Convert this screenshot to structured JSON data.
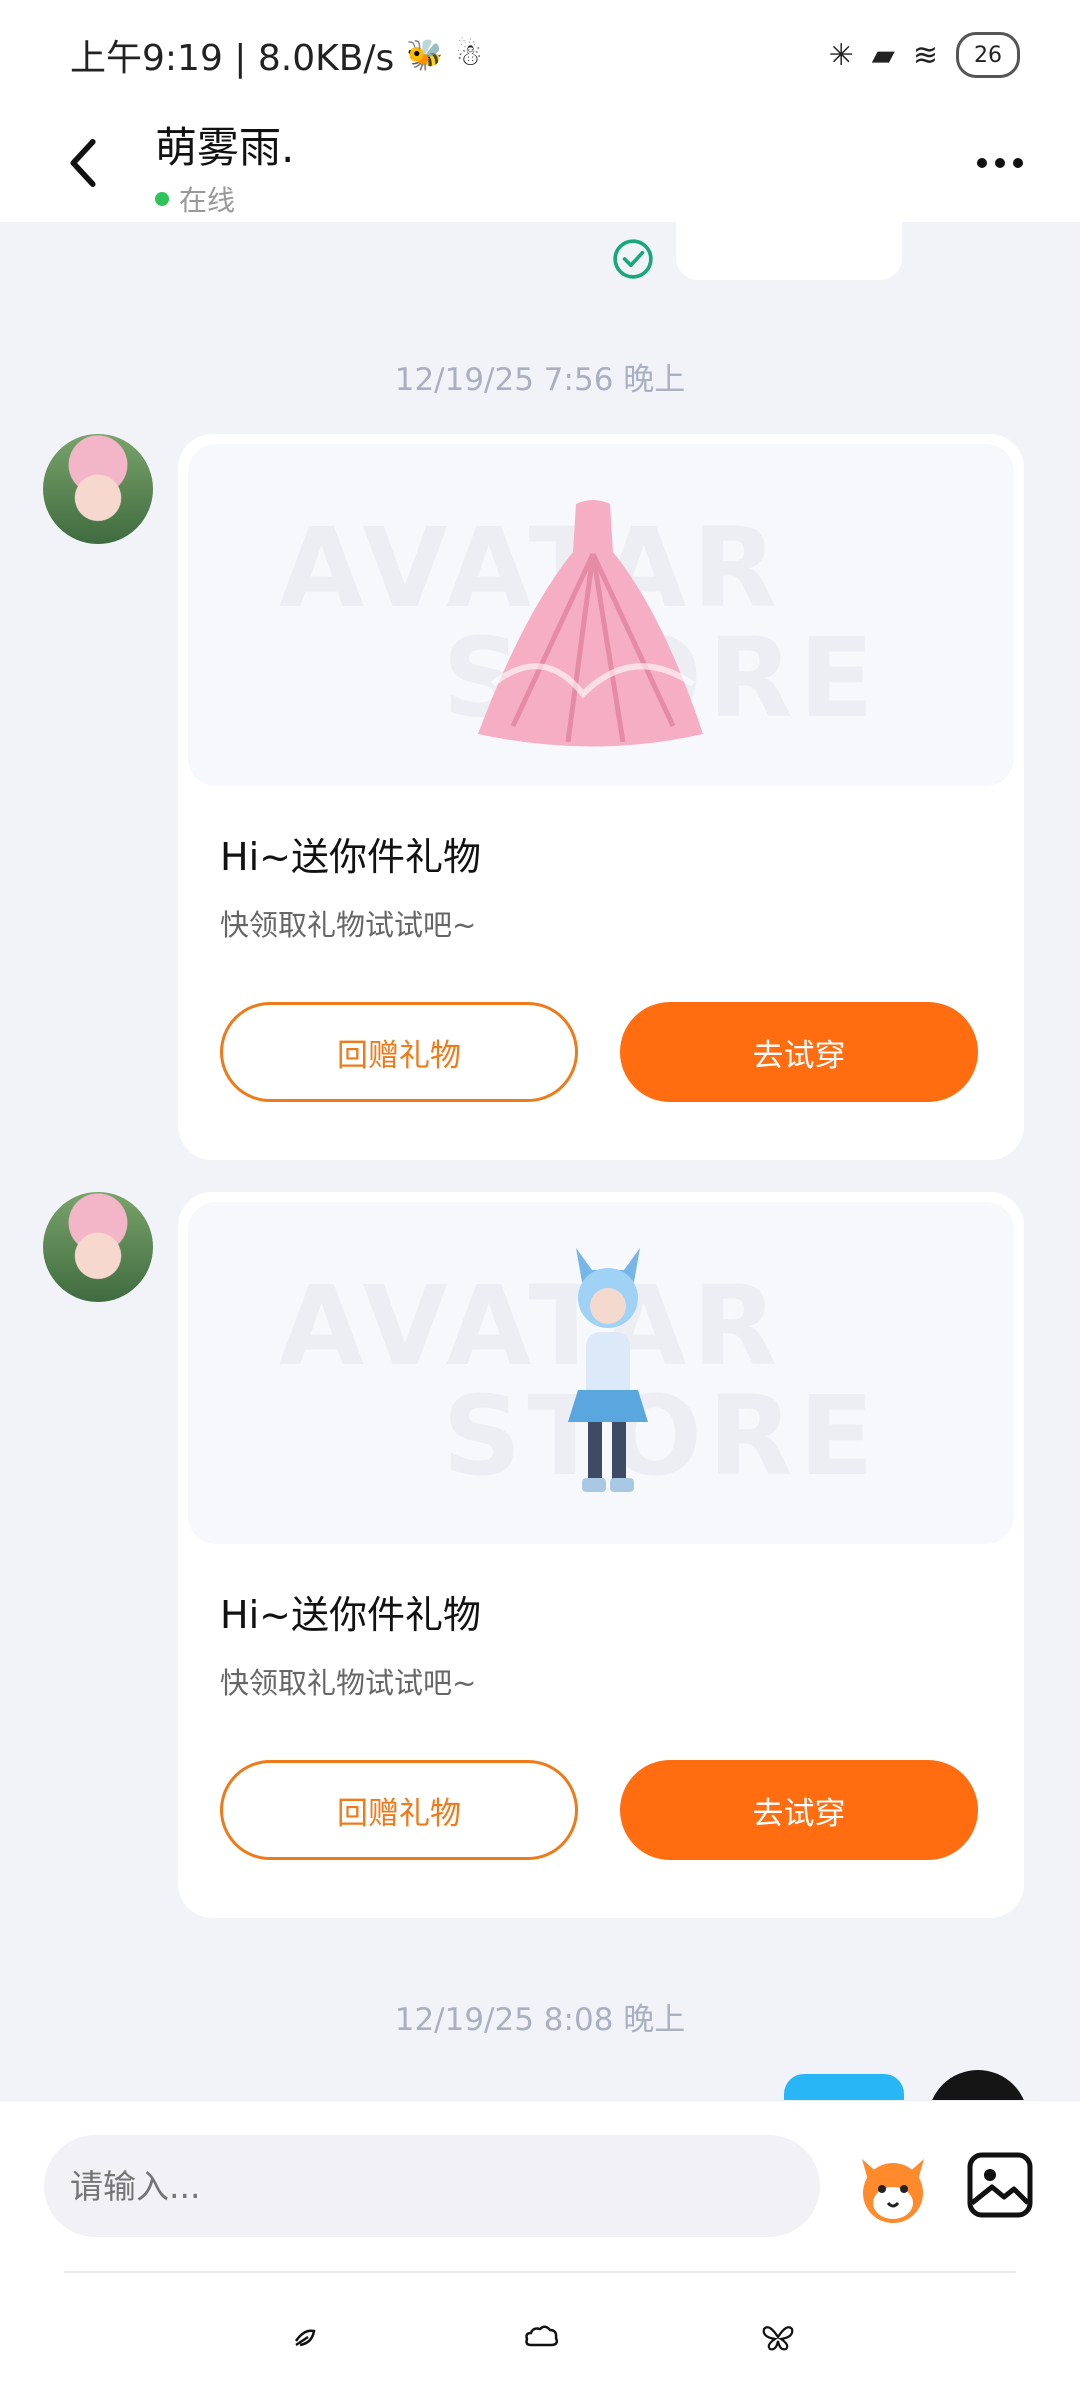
{
  "status_bar": {
    "time_speed": "上午9:19 | 8.0KB/s",
    "battery": "26"
  },
  "header": {
    "contact_name": "萌雾雨.",
    "status": "在线"
  },
  "chat": {
    "timestamps": [
      "12/19/25 7:56 晚上",
      "12/19/25 8:08 晚上"
    ],
    "cards": [
      {
        "watermark_top": "AVATAR",
        "watermark_bottom": "STORE",
        "title": "Hi~送你件礼物",
        "subtitle": "快领取礼物试试吧~",
        "return_gift_label": "回赠礼物",
        "try_on_label": "去试穿"
      },
      {
        "watermark_top": "AVATAR",
        "watermark_bottom": "STORE",
        "title": "Hi~送你件礼物",
        "subtitle": "快领取礼物试试吧~",
        "return_gift_label": "回赠礼物",
        "try_on_label": "去试穿"
      }
    ]
  },
  "composer": {
    "placeholder": "请输入..."
  },
  "colors": {
    "accent": "#ff6d10",
    "outline": "#ef7a1a",
    "online": "#2ec45a",
    "sent_bubble": "#29b6f6"
  },
  "icons": {
    "back": "chevron-left-icon",
    "more": "more-horizontal-icon",
    "read": "check-circle-icon",
    "emoji": "fox-emoji-icon",
    "image": "image-icon",
    "nav": [
      "leaf-icon",
      "cloud-icon",
      "butterfly-icon"
    ]
  }
}
